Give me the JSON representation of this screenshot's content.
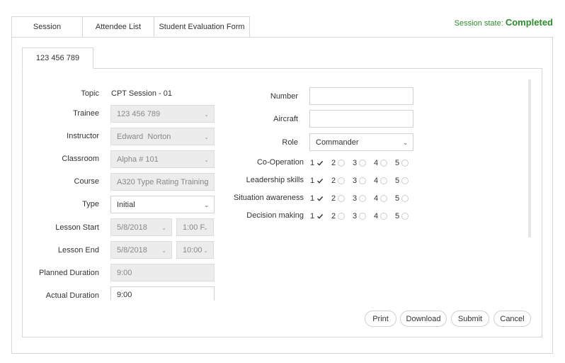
{
  "tabs": [
    {
      "label": "Session"
    },
    {
      "label": "Attendee List"
    },
    {
      "label": "Student Evaluation Form"
    }
  ],
  "session_state": {
    "label": "Session state:",
    "value": "Completed"
  },
  "subtab": {
    "label": "123 456 789"
  },
  "left_form": {
    "topic": {
      "label": "Topic",
      "value": "CPT Session - 01"
    },
    "trainee": {
      "label": "Trainee",
      "value": "123 456 789"
    },
    "instructor": {
      "label": "Instructor",
      "value": "Edward  Norton"
    },
    "classroom": {
      "label": "Classroom",
      "value": "Alpha # 101"
    },
    "course": {
      "label": "Course",
      "value": "A320 Type Rating Training"
    },
    "type": {
      "label": "Type",
      "value": "Initial"
    },
    "lesson_start": {
      "label": "Lesson Start",
      "date": "5/8/2018",
      "time": "1:00 F"
    },
    "lesson_end": {
      "label": "Lesson End",
      "date": "5/8/2018",
      "time": "10:00"
    },
    "planned_duration": {
      "label": "Planned Duration",
      "value": "9:00"
    },
    "actual_duration": {
      "label": "Actual Duration",
      "value": "9:00"
    }
  },
  "right_form": {
    "number": {
      "label": "Number",
      "value": ""
    },
    "aircraft": {
      "label": "Aircraft",
      "value": ""
    },
    "role": {
      "label": "Role",
      "value": "Commander"
    },
    "ratings": [
      {
        "label": "Co-Operation",
        "selected": 1
      },
      {
        "label": "Leadership skills",
        "selected": 1
      },
      {
        "label": "Situation awareness",
        "selected": 1
      },
      {
        "label": "Decision making",
        "selected": 1
      }
    ],
    "scale": [
      "1",
      "2",
      "3",
      "4",
      "5"
    ]
  },
  "buttons": {
    "print": "Print",
    "download": "Download",
    "submit": "Submit",
    "cancel": "Cancel"
  },
  "colors": {
    "accent": "#2e8b2e",
    "border": "#d6d6d6",
    "disabled_bg": "#ececec"
  }
}
